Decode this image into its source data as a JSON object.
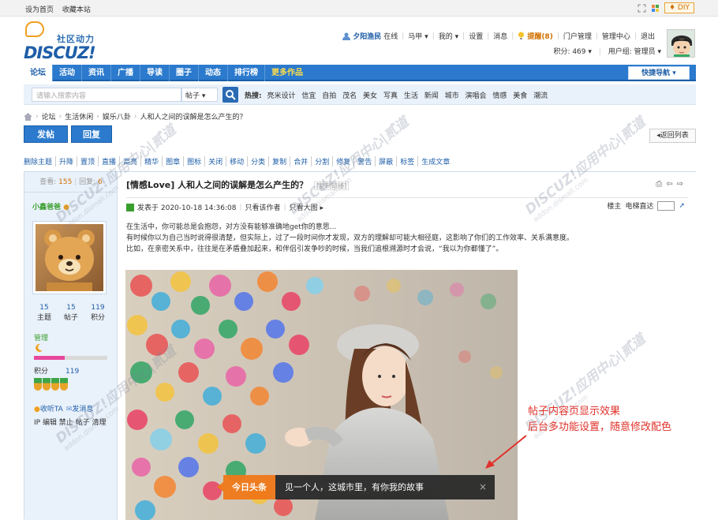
{
  "topbar": {
    "links": [
      "设为首页",
      "收藏本站"
    ],
    "diy": "DIY"
  },
  "logo": {
    "sub": "社区动力",
    "main": "DISCUZ!"
  },
  "user": {
    "name": "夕阳渔民",
    "status": "在线",
    "horse": "马甲",
    "mine": "我的",
    "settings": "设置",
    "messages": "消息",
    "remind": "提醒(8)",
    "portal": "门户管理",
    "admin": "管理中心",
    "logout": "退出",
    "points": "积分: 469",
    "group": "用户组: 管理员"
  },
  "nav": {
    "items": [
      "论坛",
      "活动",
      "资讯",
      "广播",
      "导读",
      "圈子",
      "动态",
      "排行榜"
    ],
    "more": "更多作品",
    "quick": "快捷导航"
  },
  "search": {
    "placeholder": "请输入搜索内容",
    "scope": "帖子",
    "hot_label": "热搜:",
    "hot": [
      "亮米设计",
      "信宜",
      "自拍",
      "茂名",
      "美女",
      "写真",
      "生活",
      "新闻",
      "城市",
      "演唱会",
      "情感",
      "美食",
      "潮流"
    ]
  },
  "breadcrumb": [
    "论坛",
    "生活休闲",
    "娱乐八卦",
    "人和人之间的误解是怎么产生的？"
  ],
  "buttons": {
    "post": "发帖",
    "reply": "回复",
    "back": "返回列表"
  },
  "mod_actions": [
    "删除主题",
    "升降",
    "置顶",
    "直播",
    "高亮",
    "精华",
    "图章",
    "图标",
    "关闭",
    "移动",
    "分类",
    "复制",
    "合并",
    "分割",
    "修复",
    "警告",
    "屏蔽",
    "标签",
    "生成文章"
  ],
  "sidebar": {
    "views_label": "查看:",
    "views": "155",
    "replies_label": "回复:",
    "replies": "6",
    "username": "小鑫爸爸",
    "stats": [
      {
        "n": "15",
        "l": "主题"
      },
      {
        "n": "15",
        "l": "帖子"
      },
      {
        "n": "119",
        "l": "积分"
      }
    ],
    "level": "管理",
    "progress": 0.42,
    "score_label": "积分",
    "score": "119",
    "listen": "收听TA",
    "pm": "发消息",
    "admin_links": "IP 编辑 禁止 帖子 清理"
  },
  "post": {
    "tag": "[情感Love]",
    "title": "人和人之间的误解是怎么产生的？",
    "copy": "[复制链接]",
    "posted": "发表于 2020-10-18 14:36:08",
    "author_only": "只看该作者",
    "big_image": "只看大图",
    "floor": "楼主",
    "elevator": "电梯直达",
    "paragraphs": [
      "在生活中，你可能总是会抱怨，对方没有能够准确地get你的意思...",
      "有时候你以为自己当时说得很清楚，但实际上，过了一段时间你才发现，双方的理解却可能大相径庭，这影响了你们的工作效率、关系满意度。",
      "比如，在亲密关系中，往往是在矛盾叠加起来，和伴侣引发争吵的时候，当我们追根溯源时才会说，“我以为你都懂了”。"
    ]
  },
  "annotation": {
    "line1": "帖子内容页显示效果",
    "line2": "后台多功能设置，随意修改配色"
  },
  "toast": {
    "tag": "今日头条",
    "text": "见一个人，这城市里，有你我的故事",
    "close": "×"
  },
  "watermark": {
    "main": "DISCUZ!应用中心|贰道",
    "sub": "addon.dismall.com"
  }
}
